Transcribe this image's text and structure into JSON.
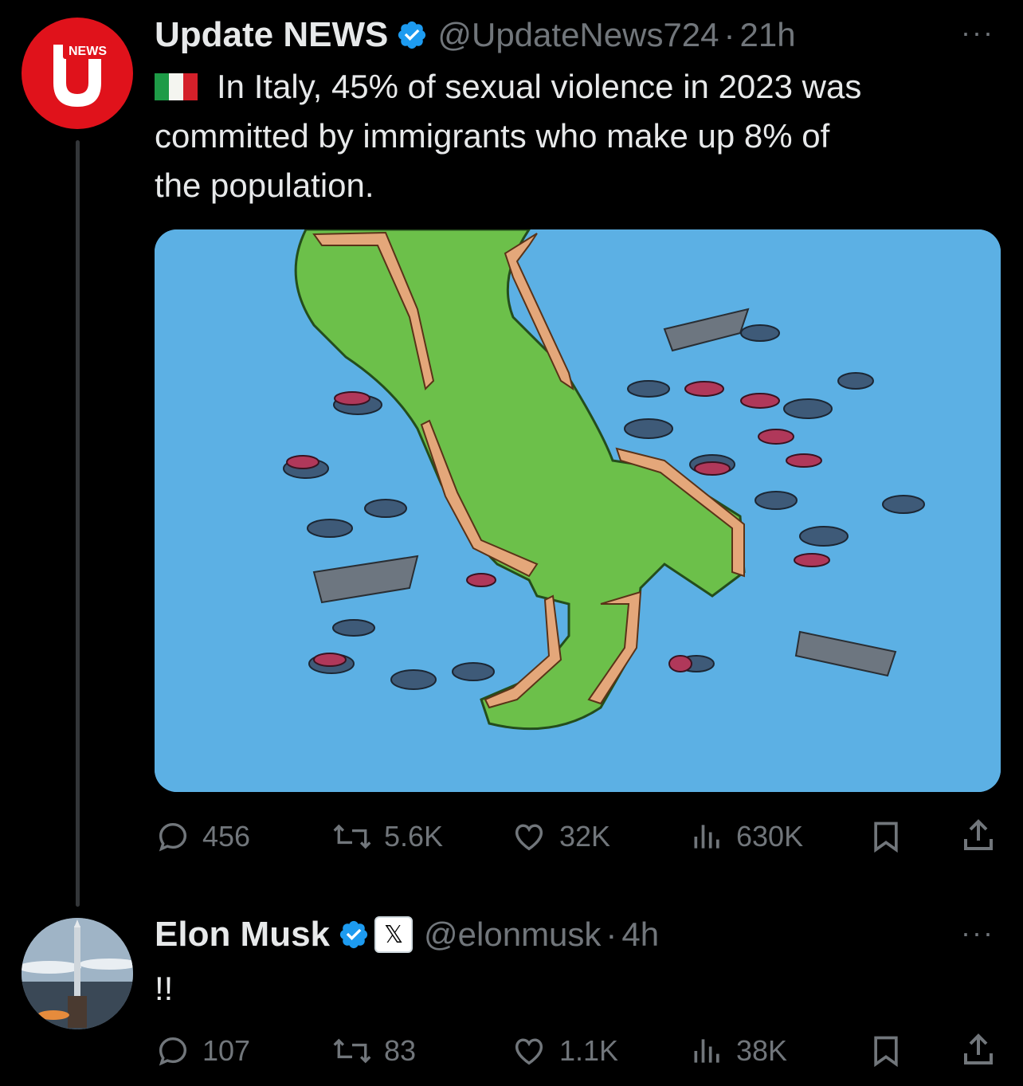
{
  "tweet1": {
    "avatar_text": "NEWS",
    "author_name": "Update NEWS",
    "handle": "@UpdateNews724",
    "separator": "·",
    "time": "21h",
    "more": "···",
    "flag_icon": "italy-flag-icon",
    "text_line1": "In Italy, 45% of sexual violence in 2023 was",
    "text_line2": "committed by immigrants who make up 8% of",
    "text_line3": "the population.",
    "replies": "456",
    "reposts": "5.6K",
    "likes": "32K",
    "views": "630K"
  },
  "tweet2": {
    "author_name": "Elon Musk",
    "affiliate_badge": "𝕏",
    "handle": "@elonmusk",
    "separator": "·",
    "time": "4h",
    "more": "···",
    "text": "!!",
    "replies": "107",
    "reposts": "83",
    "likes": "1.1K",
    "views": "38K"
  },
  "colors": {
    "background": "#000000",
    "text": "#e7e9ea",
    "muted": "#71767b",
    "verified": "#1d9bf0",
    "news_red": "#e0121b",
    "sea": "#5cb0e4",
    "land": "#6cc04a"
  }
}
